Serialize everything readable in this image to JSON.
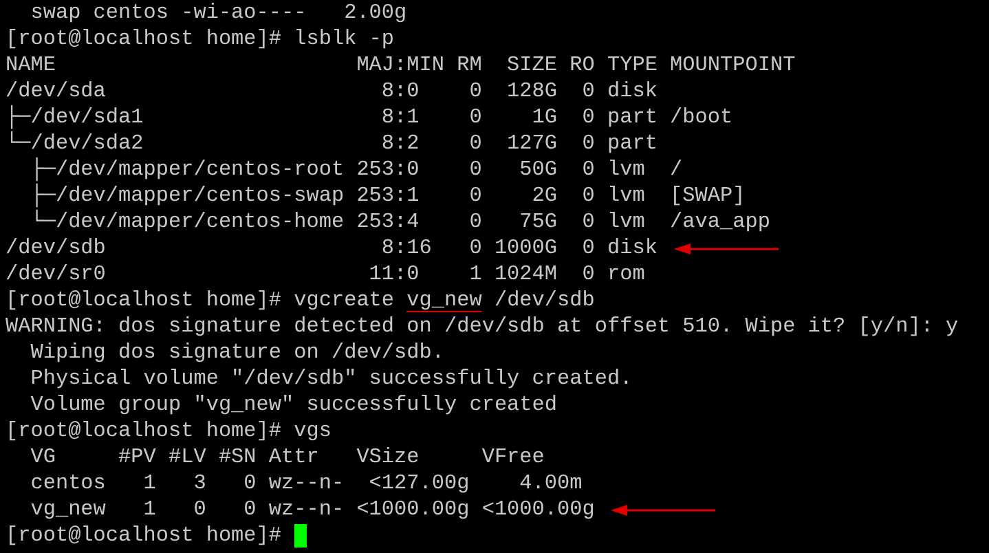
{
  "terminal": {
    "lines": [
      {
        "text": "  swap centos -wi-ao----   2.00g"
      },
      {
        "text": "[root@localhost home]# lsblk -p"
      },
      {
        "text": "NAME                        MAJ:MIN RM  SIZE RO TYPE MOUNTPOINT"
      },
      {
        "text": "/dev/sda                      8:0    0  128G  0 disk"
      },
      {
        "text": "├─/dev/sda1                   8:1    0    1G  0 part /boot"
      },
      {
        "text": "└─/dev/sda2                   8:2    0  127G  0 part"
      },
      {
        "text": "  ├─/dev/mapper/centos-root 253:0    0   50G  0 lvm  /"
      },
      {
        "text": "  ├─/dev/mapper/centos-swap 253:1    0    2G  0 lvm  [SWAP]"
      },
      {
        "text": "  └─/dev/mapper/centos-home 253:4    0   75G  0 lvm  /ava_app"
      },
      {
        "text": "/dev/sdb                      8:16   0 1000G  0 disk",
        "arrow": true
      },
      {
        "text": "/dev/sr0                     11:0    1 1024M  0 rom"
      },
      {
        "segments": [
          {
            "text": "[root@localhost home]# vgcreate ",
            "underlined": false
          },
          {
            "text": "vg_new",
            "underlined": true
          },
          {
            "text": " /dev/sdb",
            "underlined": false
          }
        ]
      },
      {
        "text": "WARNING: dos signature detected on /dev/sdb at offset 510. Wipe it? [y/n]: y"
      },
      {
        "text": "  Wiping dos signature on /dev/sdb."
      },
      {
        "text": "  Physical volume \"/dev/sdb\" successfully created."
      },
      {
        "text": "  Volume group \"vg_new\" successfully created"
      },
      {
        "text": "[root@localhost home]# vgs"
      },
      {
        "text": "  VG     #PV #LV #SN Attr   VSize     VFree"
      },
      {
        "text": "  centos   1   3   0 wz--n-  <127.00g    4.00m"
      },
      {
        "text": "  vg_new   1   0   0 wz--n- <1000.00g <1000.00g",
        "arrow": true
      },
      {
        "text": "[root@localhost home]# ",
        "cursor": true
      }
    ]
  }
}
